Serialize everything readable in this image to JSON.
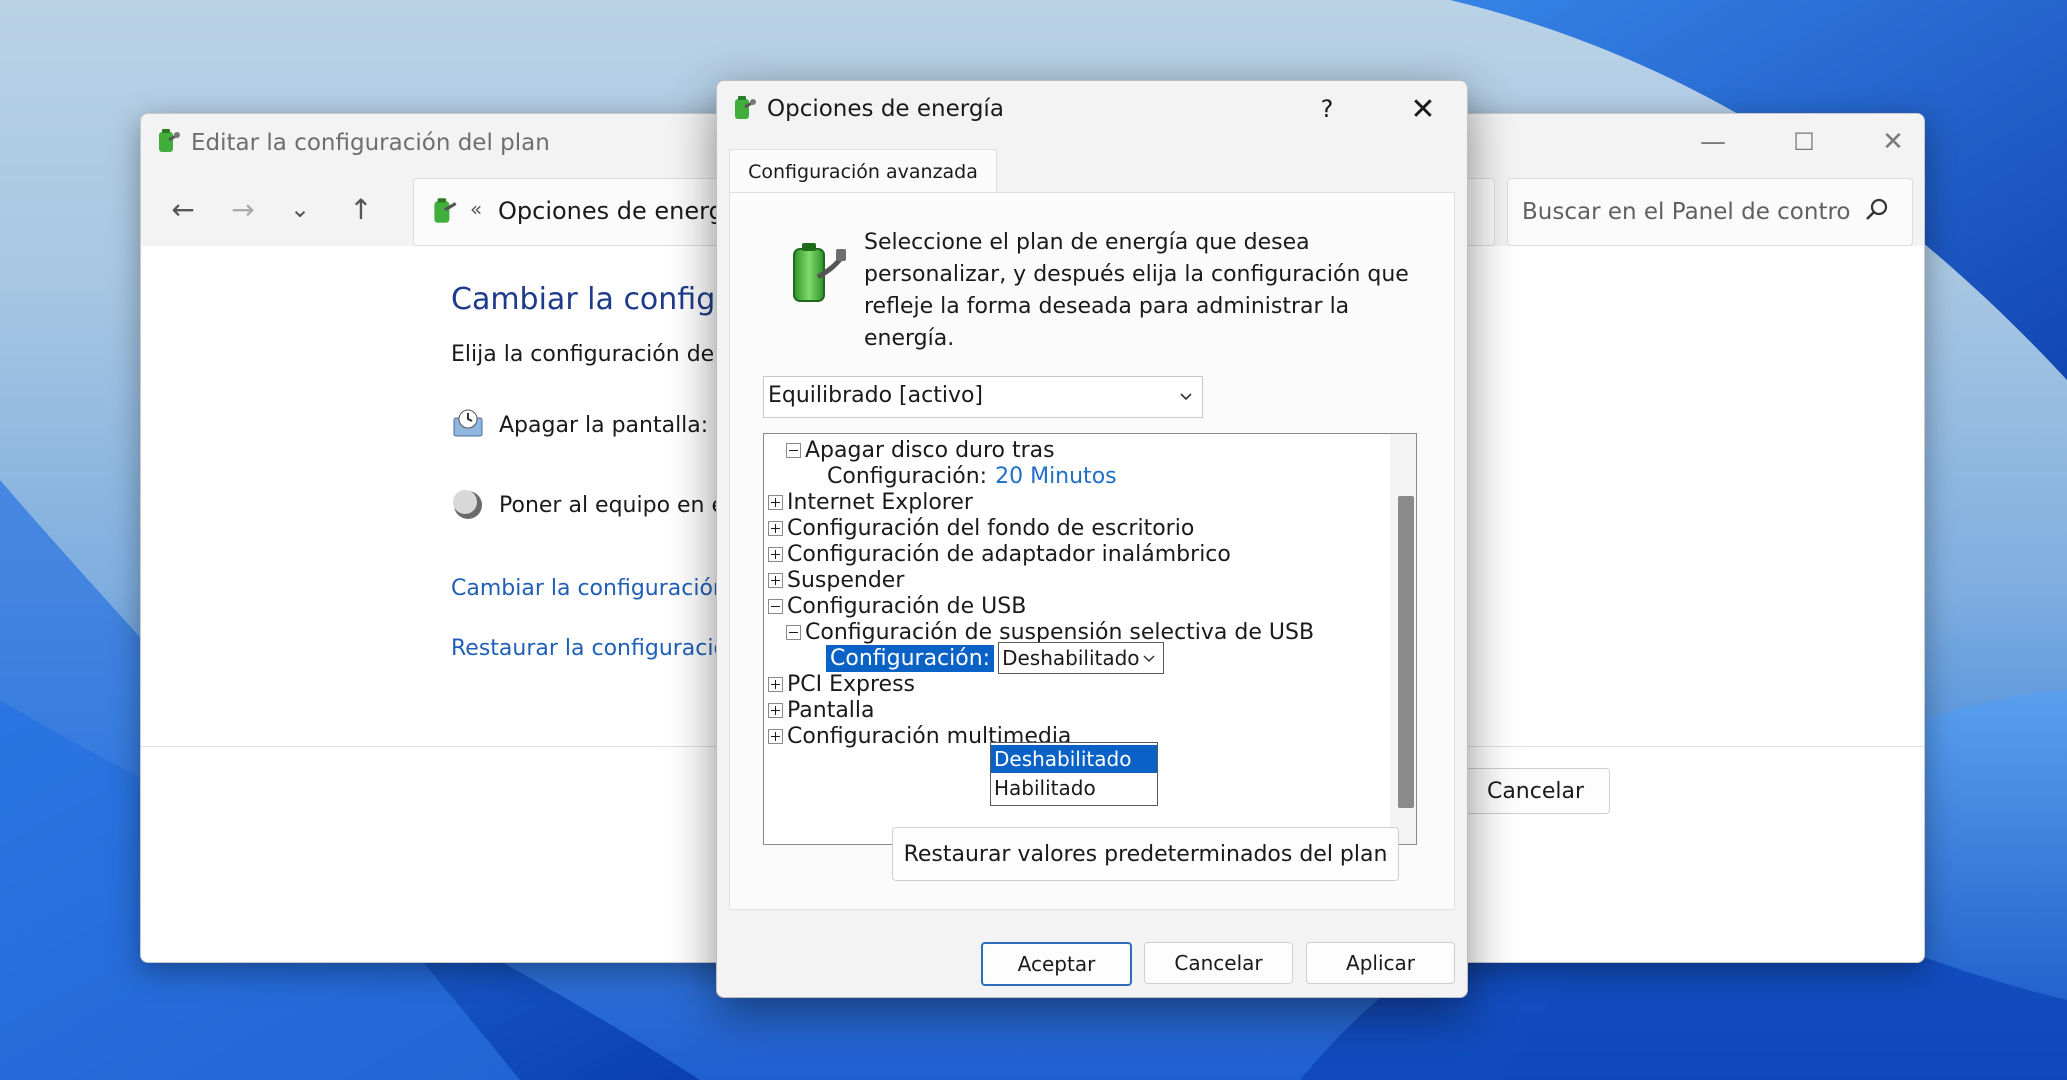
{
  "background_window": {
    "title": "Editar la configuración del plan",
    "controls": {
      "minimize": "—",
      "maximize": "☐",
      "close": "✕"
    },
    "nav": {
      "back": "←",
      "forward": "→",
      "recent": "⌄",
      "up": "↑"
    },
    "address": {
      "separator": "«",
      "text": "Opciones de energía"
    },
    "search": {
      "placeholder": "Buscar en el Panel de control"
    },
    "heading": "Cambiar la configu",
    "subheading": "Elija la configuración de r",
    "rows": [
      {
        "label": "Apagar la pantalla:",
        "icon": "display-clock-icon"
      },
      {
        "label": "Poner al equipo en e",
        "icon": "moon-sleep-icon"
      }
    ],
    "links": [
      "Cambiar la configuración",
      "Restaurar la configuració"
    ],
    "cancel_label": "Cancelar"
  },
  "dialog": {
    "title": "Opciones de energía",
    "help": "?",
    "close": "✕",
    "tab": "Configuración avanzada",
    "intro": "Seleccione el plan de energía que desea personalizar, y después elija la configuración que refleje la forma deseada para administrar la energía.",
    "plan_select": {
      "value": "Equilibrado [activo]"
    },
    "tree": {
      "hard_disk": {
        "label": "Apagar disco duro tras",
        "setting_label": "Configuración:",
        "setting_value": "20 Minutos"
      },
      "internet_explorer": "Internet Explorer",
      "desktop_background": "Configuración del fondo de escritorio",
      "wireless": "Configuración de adaptador inalámbrico",
      "suspend": "Suspender",
      "usb": "Configuración de USB",
      "usb_selective": "Configuración de suspensión selectiva de USB",
      "usb_setting_label": "Configuración:",
      "usb_setting_value": "Deshabilitado",
      "pci": "PCI Express",
      "display": "Pantalla",
      "multimedia": "Configuración multimedia"
    },
    "dropdown_options": [
      "Deshabilitado",
      "Habilitado"
    ],
    "restore_button": "Restaurar valores predeterminados del plan",
    "buttons": {
      "ok": "Aceptar",
      "cancel": "Cancelar",
      "apply": "Aplicar"
    },
    "colors": {
      "selection": "#0a62c6",
      "link": "#1f6fc9"
    }
  }
}
